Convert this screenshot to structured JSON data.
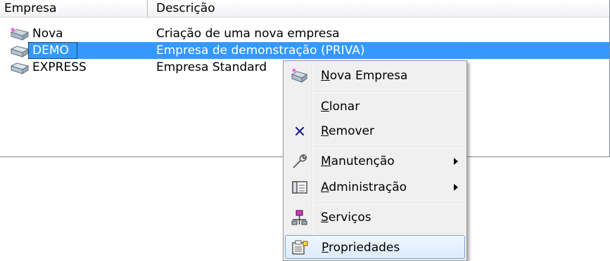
{
  "listview": {
    "columns": [
      "Empresa",
      "Descrição"
    ],
    "rows": [
      {
        "name": "Nova",
        "description": "Criação de uma nova empresa",
        "icon": "new-company-icon"
      },
      {
        "name": "DEMO",
        "description": "Empresa de demonstração (PRIVA)",
        "icon": "database-icon",
        "selected": true
      },
      {
        "name": "EXPRESS",
        "description": "Empresa Standard",
        "icon": "database-icon"
      }
    ]
  },
  "context_menu": {
    "items": [
      {
        "first": "N",
        "rest": "ova Empresa",
        "icon": "new-company-icon"
      },
      {
        "first": "C",
        "rest": "lonar",
        "icon": "none"
      },
      {
        "first": "R",
        "rest": "emover",
        "icon": "remove-x-icon"
      },
      {
        "first": "M",
        "rest": "anutenção",
        "icon": "wrench-icon",
        "submenu": true
      },
      {
        "first": "A",
        "rest": "dministração",
        "icon": "admin-window-icon",
        "submenu": true
      },
      {
        "first": "S",
        "rest": "erviços",
        "icon": "services-icon"
      },
      {
        "first": "P",
        "rest": "ropriedades",
        "icon": "properties-icon",
        "highlighted": true
      }
    ]
  },
  "colors": {
    "selection": "#3399ff",
    "remove": "#1f1f8a"
  }
}
